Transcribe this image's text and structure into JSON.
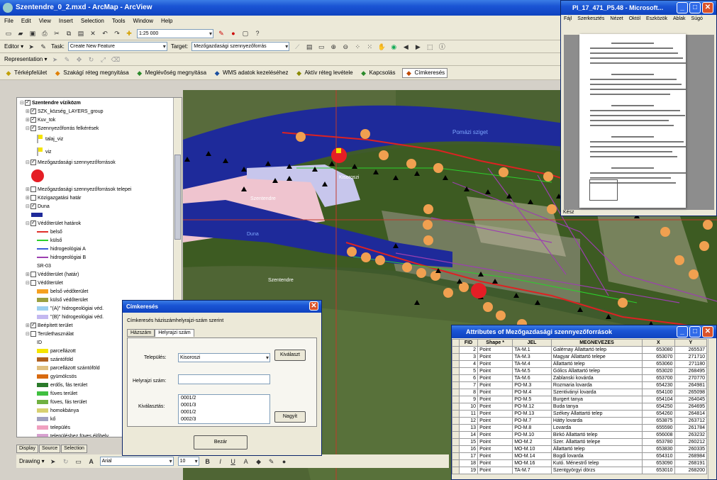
{
  "app": {
    "title": "Szentendre_0_2.mxd - ArcMap - ArcView",
    "menu": [
      "File",
      "Edit",
      "View",
      "Insert",
      "Selection",
      "Tools",
      "Window",
      "Help"
    ]
  },
  "toolbars": {
    "scale": "1:25 000",
    "editor_label": "Editor ▾",
    "task_label": "Task:",
    "task_value": "Create New Feature",
    "target_label": "Target:",
    "target_value": "Mezőgazdasági szennyezőforrás",
    "representation_label": "Representation ▾",
    "custom_items": [
      "Térképfelület",
      "Szakágí réteg megnyitása",
      "Meglévőség megnyitása",
      "WMS adatok kezeléséhez",
      "Aktív réteg levétele",
      "Kapcsolás",
      "Címkeresés"
    ]
  },
  "toc": {
    "rows": [
      {
        "label": "Szentendre víziközm",
        "check": "✓",
        "expander": "⊟",
        "bold": true,
        "legend": null,
        "indent": 0
      },
      {
        "label": "SZK_község_LAYERS_group",
        "check": "✓",
        "expander": "⊞",
        "bold": false,
        "legend": null,
        "indent": 1
      },
      {
        "label": "Kuv_tok",
        "check": "✓",
        "expander": "⊞",
        "bold": false,
        "legend": null,
        "indent": 1
      },
      {
        "label": "Szennyezőforrás felkérések",
        "check": "✓",
        "expander": "⊟",
        "bold": false,
        "legend": null,
        "indent": 1
      },
      {
        "label": "talaj_viz",
        "check": "",
        "expander": "",
        "bold": false,
        "legend": "flag",
        "indent": 3
      },
      {
        "label": "viz",
        "check": "",
        "expander": "",
        "bold": false,
        "legend": "flag",
        "indent": 3
      },
      {
        "label": "Mezőgazdasági szennyezőforrások",
        "check": "✓",
        "expander": "⊟",
        "bold": false,
        "legend": null,
        "indent": 1
      },
      {
        "label": "",
        "check": "",
        "expander": "",
        "bold": false,
        "legend": "redcircle",
        "indent": 2
      },
      {
        "label": "Mezőgazdasági szennyezőforrások telepei",
        "check": "",
        "expander": "⊞",
        "bold": false,
        "legend": null,
        "indent": 1
      },
      {
        "label": "Közigazgatási határ",
        "check": "",
        "expander": "⊞",
        "bold": false,
        "legend": null,
        "indent": 1
      },
      {
        "label": "Duna",
        "check": "✓",
        "expander": "⊟",
        "bold": false,
        "legend": null,
        "indent": 1
      },
      {
        "label": "",
        "check": "",
        "expander": "",
        "bold": false,
        "legend": "navy",
        "indent": 2
      },
      {
        "label": "Védőterület határok",
        "check": "✓",
        "expander": "⊟",
        "bold": false,
        "legend": null,
        "indent": 1
      },
      {
        "label": "belső",
        "check": "",
        "expander": "",
        "bold": false,
        "legend": "red",
        "indent": 3
      },
      {
        "label": "külső",
        "check": "",
        "expander": "",
        "bold": false,
        "legend": "green",
        "indent": 3
      },
      {
        "label": "hidrogeológiai A",
        "check": "",
        "expander": "",
        "bold": false,
        "legend": "blue",
        "indent": 3
      },
      {
        "label": "hidrogeológiai B",
        "check": "",
        "expander": "",
        "bold": false,
        "legend": "purple",
        "indent": 3
      },
      {
        "label": "SR-03",
        "check": "",
        "expander": "",
        "bold": false,
        "legend": null,
        "indent": 3
      },
      {
        "label": "Védőterület (határ)",
        "check": "",
        "expander": "⊞",
        "bold": false,
        "legend": null,
        "indent": 1
      },
      {
        "label": "Védőterület",
        "check": "",
        "expander": "⊟",
        "bold": false,
        "legend": null,
        "indent": 1
      },
      {
        "label": "belső védőterület",
        "check": "",
        "expander": "",
        "bold": false,
        "legend": "orange",
        "indent": 3
      },
      {
        "label": "külső védőterület",
        "check": "",
        "expander": "",
        "bold": false,
        "legend": "olive",
        "indent": 3
      },
      {
        "label": "\"(A)\" hidrogeológiai véd.",
        "check": "",
        "expander": "",
        "bold": false,
        "legend": "lightblue",
        "indent": 3
      },
      {
        "label": "\"(B)\" hidrogeológiai véd.",
        "check": "",
        "expander": "",
        "bold": false,
        "legend": "lavender",
        "indent": 3
      },
      {
        "label": "Beépített terület",
        "check": "✓",
        "expander": "⊞",
        "bold": false,
        "legend": null,
        "indent": 1
      },
      {
        "label": "Területhasználat",
        "check": "",
        "expander": "⊟",
        "bold": false,
        "legend": null,
        "indent": 1
      },
      {
        "label": "ID",
        "check": "",
        "expander": "",
        "bold": false,
        "legend": null,
        "indent": 3
      },
      {
        "label": "parcellázott",
        "check": "",
        "expander": "",
        "bold": false,
        "legend": "yellow",
        "indent": 3
      },
      {
        "label": "szántóföld",
        "check": "",
        "expander": "",
        "bold": false,
        "legend": "brown",
        "indent": 3
      },
      {
        "label": "parcellázott szántóföld",
        "check": "",
        "expander": "",
        "bold": false,
        "legend": "sand",
        "indent": 3
      },
      {
        "label": "gyümölcsös",
        "check": "",
        "expander": "",
        "bold": false,
        "legend": "darkorange",
        "indent": 3
      },
      {
        "label": "erdős, fás terület",
        "check": "",
        "expander": "",
        "bold": false,
        "legend": "darkgreen",
        "indent": 3
      },
      {
        "label": "füves terület",
        "check": "",
        "expander": "",
        "bold": false,
        "legend": "lime",
        "indent": 3
      },
      {
        "label": "füves, fás terület",
        "check": "",
        "expander": "",
        "bold": false,
        "legend": "midgreen",
        "indent": 3
      },
      {
        "label": "homokbánya",
        "check": "",
        "expander": "",
        "bold": false,
        "legend": "khaki",
        "indent": 3
      },
      {
        "label": "kő",
        "check": "",
        "expander": "",
        "bold": false,
        "legend": "slate",
        "indent": 3
      },
      {
        "label": "település",
        "check": "",
        "expander": "",
        "bold": false,
        "legend": "pink",
        "indent": 3
      },
      {
        "label": "településhez füves élőhely",
        "check": "",
        "expander": "",
        "bold": false,
        "legend": "rose",
        "indent": 3
      }
    ],
    "tabs": [
      "Display",
      "Source",
      "Selection"
    ]
  },
  "drawing": {
    "label": "Drawing ▾",
    "font": "Arial",
    "size": "10"
  },
  "map_labels": [
    "Pomázi sziget",
    "Szentendre",
    "Szentendre",
    "Kisoroszi",
    "Duna"
  ],
  "search_dialog": {
    "title": "Címkeresés",
    "description": "Címkeresés háziszámhelyrajzi-szám szerint",
    "tabs": [
      "Házszám",
      "Helyrajzi szám"
    ],
    "settlement_label": "Település:",
    "settlement_value": "Kisoroszi",
    "select_button": "Kiválaszt",
    "parcel_label": "Helyrajzi szám:",
    "parcel_value": "",
    "lot_label": "Kiválasztás:",
    "lots": [
      "0001/2",
      "0001/3",
      "0001/2",
      "0002/3"
    ],
    "show_button": "Nagyít",
    "close_button": "Bezár"
  },
  "attr_table": {
    "title": "Attributes of Mezőgazdasági szennyezőforrások",
    "headers": [
      "FID",
      "Shape *",
      "JEL",
      "MEGNEVEZES",
      "X",
      "Y"
    ],
    "rows": [
      [
        "2",
        "Point",
        "TA-M.1",
        "Galérnay Állattartó telep",
        "653080",
        "265537"
      ],
      [
        "3",
        "Point",
        "TA-M.3",
        "Magyar Állattartó telepe",
        "653070",
        "271710"
      ],
      [
        "4",
        "Point",
        "TA-M.4",
        "Állattartó telep",
        "653060",
        "271180"
      ],
      [
        "5",
        "Point",
        "TA-M.5",
        "Gólics Állattartó telep",
        "653020",
        "268495"
      ],
      [
        "6",
        "Point",
        "TA-M.6",
        "Zablanski kovárda",
        "653700",
        "270770"
      ],
      [
        "7",
        "Point",
        "PO-M.3",
        "Rozmaria lovarda",
        "654230",
        "264981"
      ],
      [
        "8",
        "Point",
        "PO-M.4",
        "Szentiványi lovarda",
        "654100",
        "265098"
      ],
      [
        "9",
        "Point",
        "PO-M.5",
        "Burgert tanya",
        "654104",
        "264045"
      ],
      [
        "10",
        "Point",
        "PO-M.12",
        "Buda tanya",
        "654250",
        "264695"
      ],
      [
        "11",
        "Point",
        "PO-M.13",
        "Székey Állattartó telep",
        "654260",
        "264814"
      ],
      [
        "12",
        "Point",
        "PO-M.7",
        "Hátty lovarda",
        "653875",
        "263712"
      ],
      [
        "13",
        "Point",
        "PO-M.8",
        "Lovarda",
        "655590",
        "261784"
      ],
      [
        "14",
        "Point",
        "PO-M.10",
        "Birkó Állattartó telep",
        "656008",
        "263232"
      ],
      [
        "15",
        "Point",
        "MO-M.2",
        "Szer. Állattartó telepe",
        "653780",
        "260212"
      ],
      [
        "16",
        "Point",
        "MO-M.10",
        "Állattartó telep",
        "653830",
        "260335"
      ],
      [
        "17",
        "Point",
        "MO-M.14",
        "Bogdi lovarda",
        "654310",
        "268984"
      ],
      [
        "18",
        "Point",
        "MO-M.16",
        "Kutó. Ménestrő telep",
        "653090",
        "268191"
      ],
      [
        "19",
        "Point",
        "TA-M.7",
        "Szentgyörgyi dörzs",
        "653010",
        "268200"
      ]
    ]
  },
  "word": {
    "title": "PI_17_471_P5.48 - Microsoft...",
    "menu": [
      "Fájl",
      "Szerkesztés",
      "Nézet",
      "Októl",
      "Eszközök",
      "Ablak",
      "Súgó"
    ],
    "status": "Kész"
  }
}
